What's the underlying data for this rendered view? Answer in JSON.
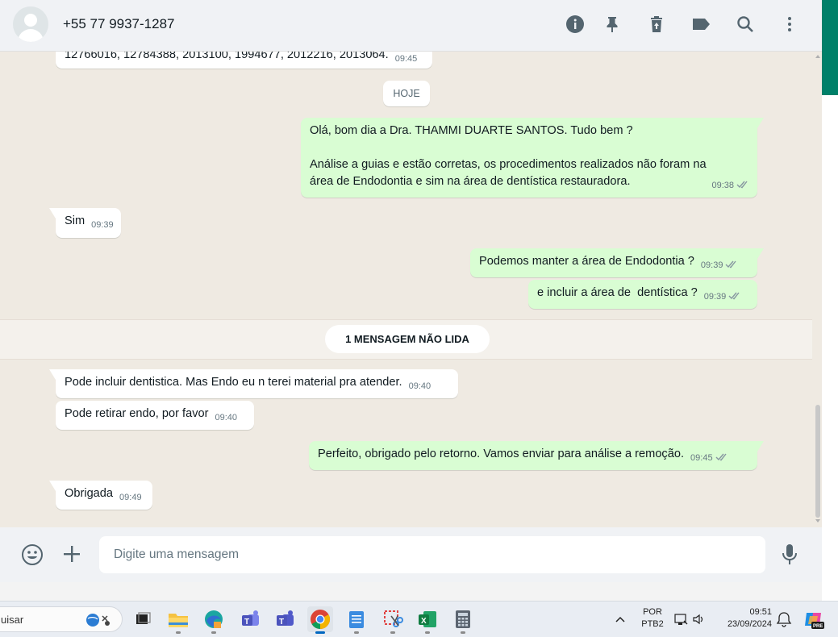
{
  "header": {
    "contact_name": "+55 77 9937-1287",
    "icons": [
      "info-icon",
      "pin-icon",
      "delete-icon",
      "label-icon",
      "search-icon",
      "menu-icon"
    ]
  },
  "chat": {
    "top_partial_message": {
      "text": "12766016, 12784388, 2013100, 1994677, 2012216, 2013064.",
      "time": "09:45"
    },
    "date_chip": "HOJE",
    "messages": [
      {
        "dir": "out",
        "lines": [
          "Olá, bom dia a Dra. THAMMI DUARTE SANTOS. Tudo bem ?",
          "",
          "Análise a guias e estão corretas, os procedimentos realizados não foram na",
          "área de Endodontia e sim na área de dentística restauradora."
        ],
        "time": "09:38"
      },
      {
        "dir": "in",
        "text": "Sim",
        "time": "09:39"
      },
      {
        "dir": "out",
        "text": "Podemos manter a área de Endodontia ?",
        "time": "09:39"
      },
      {
        "dir": "out",
        "text": "e incluir a área de  dentística ?",
        "time": "09:39"
      },
      {
        "dir": "in",
        "text": "Pode incluir dentistica. Mas Endo eu n terei material pra atender.",
        "time": "09:40"
      },
      {
        "dir": "in",
        "text": "Pode retirar endo, por favor",
        "time": "09:40"
      },
      {
        "dir": "out",
        "text": "Perfeito, obrigado pelo retorno. Vamos enviar para análise a remoção.",
        "time": "09:45"
      },
      {
        "dir": "in",
        "text": "Obrigada",
        "time": "09:49"
      }
    ],
    "unread_label": "1 MENSAGEM NÃO LIDA"
  },
  "composer": {
    "placeholder": "Digite uma mensagem"
  },
  "taskbar": {
    "search_text": "uisar",
    "lang_line1": "POR",
    "lang_line2": "PTB2",
    "time": "09:51",
    "date": "23/09/2024",
    "apps": [
      "task-view",
      "file-explorer",
      "edge",
      "teams",
      "teams-classic",
      "chrome",
      "notepad",
      "snipping-tool",
      "excel",
      "calculator"
    ]
  },
  "colors": {
    "accent": "#008069",
    "outgoing_bubble": "#d9fdd3",
    "incoming_bubble": "#ffffff",
    "chat_background": "#efeae2",
    "tick_gray": "#8696a0"
  }
}
